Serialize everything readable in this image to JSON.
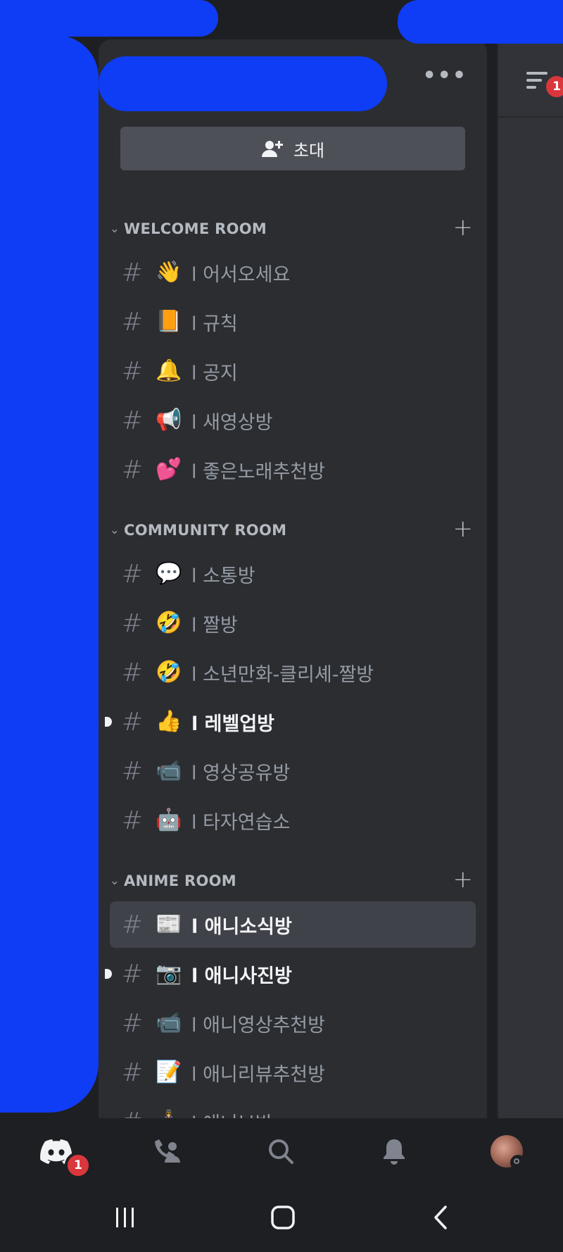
{
  "server_header": {
    "more_label": "•••"
  },
  "invite_button": {
    "label": "초대"
  },
  "categories": [
    {
      "label": "WELCOME ROOM",
      "channels": [
        {
          "emoji": "👋",
          "name": "l 어서오세요"
        },
        {
          "emoji": "📙",
          "name": "l 규칙"
        },
        {
          "emoji": "🔔",
          "name": "l 공지"
        },
        {
          "emoji": "📢",
          "name": "l 새영상방"
        },
        {
          "emoji": "💕",
          "name": "l 좋은노래추천방"
        }
      ]
    },
    {
      "label": "COMMUNITY ROOM",
      "channels": [
        {
          "emoji": "💬",
          "name": "l 소통방"
        },
        {
          "emoji": "🤣",
          "name": "l 짤방"
        },
        {
          "emoji": "🤣",
          "name": "l 소년만화-클리셰-짤방"
        },
        {
          "emoji": "👍",
          "name": "l 레벨업방",
          "unread": true
        },
        {
          "emoji": "📹",
          "name": "l 영상공유방"
        },
        {
          "emoji": "🤖",
          "name": "l 타자연습소"
        }
      ]
    },
    {
      "label": "ANIME ROOM",
      "channels": [
        {
          "emoji": "📰",
          "name": "l 애니소식방",
          "selected": true
        },
        {
          "emoji": "📷",
          "name": "l 애니사진방",
          "unread": true
        },
        {
          "emoji": "📹",
          "name": "l 애니영상추천방"
        },
        {
          "emoji": "📝",
          "name": "l 애니리뷰추천방"
        },
        {
          "emoji": "🕴",
          "name": "l 애니보방"
        }
      ]
    }
  ],
  "members_badge": "1",
  "tabbar": {
    "home_badge": "1"
  },
  "colors": {
    "background": "#1e1f22",
    "panel": "#2b2d31",
    "selected": "#404249",
    "badge": "#da373c",
    "redaction": "#0f3cf5"
  },
  "icons": [
    "discord-home-icon",
    "friends-icon",
    "search-icon",
    "bell-icon",
    "avatar",
    "recents-icon",
    "home-icon",
    "back-icon",
    "member-list-icon",
    "add-user-icon"
  ]
}
